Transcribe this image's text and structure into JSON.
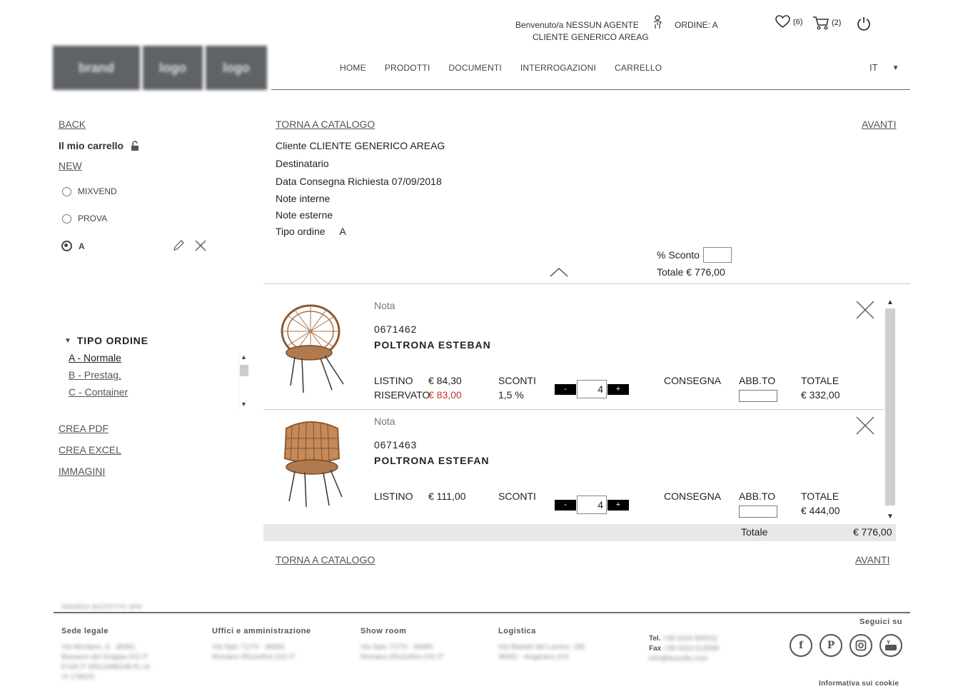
{
  "header": {
    "welcome": "Benvenuto/a NESSUN AGENTE",
    "customer": "CLIENTE GENERICO AREAG",
    "order_label": "ORDINE: A",
    "wishlist_count": "(6)",
    "cart_count": "(2)",
    "language": "IT",
    "logo_parts": [
      "brand",
      "logo",
      "logo"
    ]
  },
  "nav": [
    "HOME",
    "PRODOTTI",
    "DOCUMENTI",
    "INTERROGAZIONI",
    "CARRELLO"
  ],
  "sidebar": {
    "back": "BACK",
    "my_cart": "Il mio carrello",
    "new": "NEW",
    "carts": [
      {
        "label": "MIXVEND",
        "selected": false
      },
      {
        "label": "PROVA",
        "selected": false
      },
      {
        "label": "A",
        "selected": true
      }
    ],
    "tipo_ordine_title": "TIPO ORDINE",
    "tipo_ordine_options": [
      "A - Normale",
      "B - Prestag.",
      "C - Container"
    ],
    "actions": [
      "CREA PDF",
      "CREA EXCEL",
      "IMMAGINI"
    ]
  },
  "main": {
    "back_to_catalog": "TORNA A CATALOGO",
    "next": "AVANTI",
    "cliente_label": "Cliente",
    "cliente_value": "CLIENTE GENERICO AREAG",
    "destinatario_label": "Destinatario",
    "data_label": "Data Consegna Richiesta",
    "data_value": "07/09/2018",
    "note_interne": "Note interne",
    "note_esterne": "Note esterne",
    "tipo_ordine_label": "Tipo ordine",
    "tipo_ordine_value": "A",
    "sconto_label": "% Sconto",
    "totale_top": "Totale € 776,00",
    "totale_label": "Totale",
    "totale_value": "€ 776,00"
  },
  "products": [
    {
      "nota": "Nota",
      "code": "0671462",
      "name": "POLTRONA ESTEBAN",
      "listino_label": "LISTINO",
      "listino_value": "€ 84,30",
      "riservato_label": "RISERVATO",
      "riservato_value": "€ 83,00",
      "sconti_label": "SCONTI",
      "sconti_value": "1,5 %",
      "qty": "4",
      "minus": "-",
      "plus": "+",
      "consegna_label": "CONSEGNA",
      "abb_label": "ABB.TO",
      "totale_label": "TOTALE",
      "totale_value": "€ 332,00"
    },
    {
      "nota": "Nota",
      "code": "0671463",
      "name": "POLTRONA ESTEFAN",
      "listino_label": "LISTINO",
      "listino_value": "€ 111,00",
      "sconti_label": "SCONTI",
      "qty": "4",
      "minus": "-",
      "plus": "+",
      "consegna_label": "CONSEGNA",
      "abb_label": "ABB.TO",
      "totale_label": "TOTALE",
      "totale_value": "€ 444,00"
    }
  ],
  "footer": {
    "company": "ANDREA BIZZOTTO SPA",
    "sede_legale": "Sede legale",
    "uffici": "Uffici e amministrazione",
    "show_room": "Show room",
    "logistica": "Logistica",
    "tel_label": "Tel.",
    "fax_label": "Fax",
    "seguici": "Seguici su",
    "cookie": "Informativa sui cookie",
    "social": [
      "facebook-icon",
      "pinterest-icon",
      "instagram-icon",
      "youtube-icon"
    ],
    "blurred_lines": {
      "sede": [
        "Via Montano, 9 - 36061",
        "Bassano del Grappa (VI) IT",
        "P.IVA IT 00514490248 R.I.A.",
        "VI 179623"
      ],
      "uffici": [
        "Via Spin 71/73 - 36060",
        "Romano d'Ezzelino (VI) IT"
      ],
      "show": [
        "Via Spin 71/73 - 36060",
        "Romano d'Ezzelino (VI) IT"
      ],
      "logistica": [
        "Via Maestri del Lavoro, 180",
        "36061 - Angarano (VI)"
      ],
      "contacts": [
        "+39 0424 800011",
        "+39 0424 513699",
        "info@bizzotto.com"
      ]
    }
  }
}
